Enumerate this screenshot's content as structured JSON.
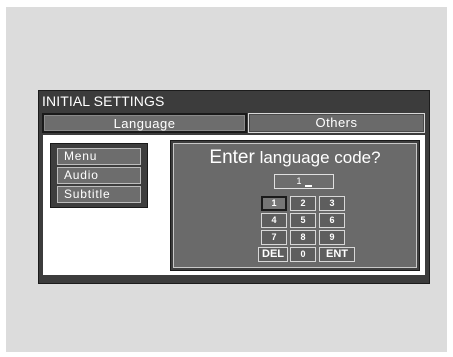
{
  "window": {
    "title": "INITIAL SETTINGS"
  },
  "tabs": [
    {
      "label": "Language"
    },
    {
      "label": "Others"
    }
  ],
  "menu": {
    "items": [
      {
        "label": "Menu"
      },
      {
        "label": "Audio"
      },
      {
        "label": "Subtitle"
      }
    ]
  },
  "code_entry": {
    "prompt_first": "Enter",
    "prompt_rest": "language code?",
    "current_value": "1",
    "keypad": {
      "keys": [
        "1",
        "2",
        "3",
        "4",
        "5",
        "6",
        "7",
        "8",
        "9",
        "DEL",
        "0",
        "ENT"
      ],
      "selected": "1"
    }
  }
}
